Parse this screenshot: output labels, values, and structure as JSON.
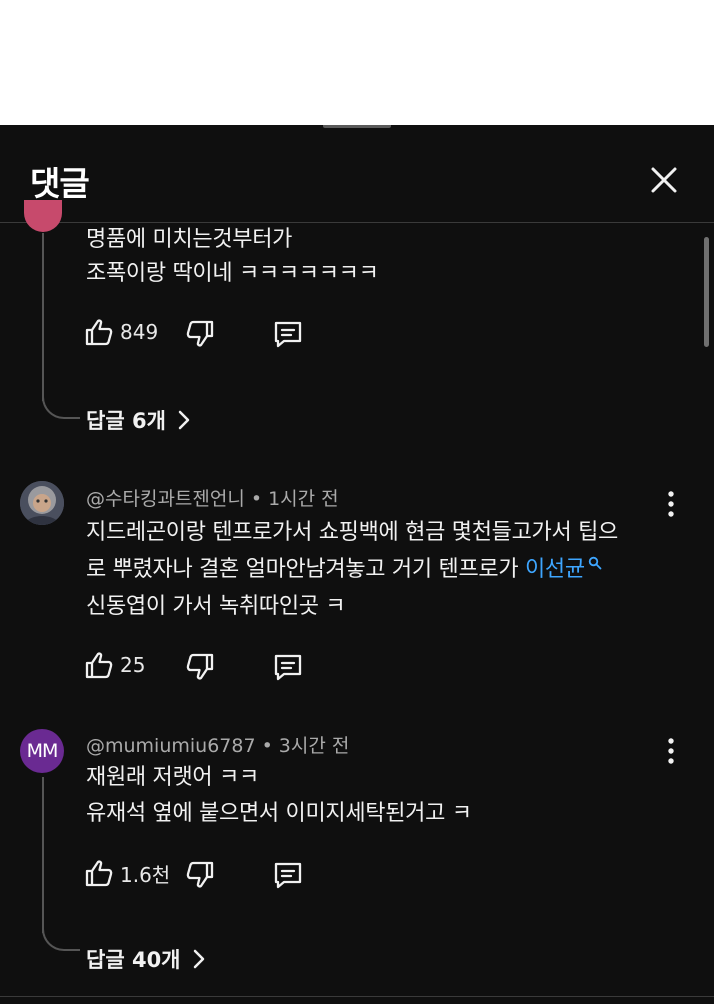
{
  "sheet": {
    "title": "댓글"
  },
  "comments": [
    {
      "lines": [
        "명품에 미치는것부터가",
        "조폭이랑 딱이네 ㅋㅋㅋㅋㅋㅋㅋ"
      ],
      "likes": "849",
      "replies_label": "답글 6개"
    },
    {
      "author": "@수타킹과트젠언니",
      "time": "1시간 전",
      "line1": "지드레곤이랑 텐프로가서 쇼핑백에 현금 몇천들고가서 팁으",
      "line2_pre": "로 뿌렸자나 결혼 얼마안남겨놓고 거기 텐프로가 ",
      "mention": "이선균",
      "line3": "신동엽이 가서 녹취따인곳 ㅋ",
      "likes": "25"
    },
    {
      "author": "@mumiumiu6787",
      "time": "3시간 전",
      "avatar_initials": "MM",
      "lines": [
        "재원래 저랫어 ㅋㅋ",
        "유재석 옆에 붙으면서 이미지세탁된거고 ㅋ"
      ],
      "likes": "1.6천",
      "replies_label": "답글 40개"
    }
  ],
  "colors": {
    "background": "#0f0f0f",
    "text": "#f1f1f1",
    "secondary": "#aaaaaa",
    "link": "#3ea6ff",
    "mm_avatar": "#6a2a92"
  },
  "icons": [
    "close-icon",
    "thumbs-up-icon",
    "thumbs-down-icon",
    "reply-icon",
    "more-vert-icon",
    "chevron-right-icon",
    "search-icon"
  ]
}
